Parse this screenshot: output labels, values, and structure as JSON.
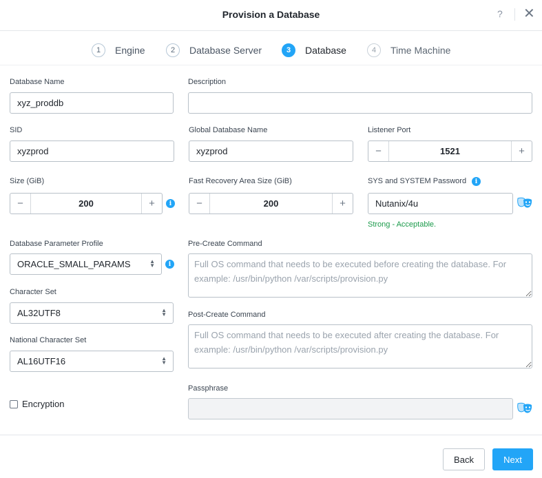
{
  "dialog": {
    "title": "Provision a Database",
    "help": "?",
    "close": "✕"
  },
  "steps": [
    {
      "num": "1",
      "label": "Engine"
    },
    {
      "num": "2",
      "label": "Database Server"
    },
    {
      "num": "3",
      "label": "Database"
    },
    {
      "num": "4",
      "label": "Time Machine"
    }
  ],
  "form": {
    "db_name": {
      "label": "Database Name",
      "value": "xyz_proddb"
    },
    "description": {
      "label": "Description",
      "value": ""
    },
    "sid": {
      "label": "SID",
      "value": "xyzprod"
    },
    "global_db_name": {
      "label": "Global Database Name",
      "value": "xyzprod"
    },
    "listener_port": {
      "label": "Listener Port",
      "value": "1521"
    },
    "size": {
      "label": "Size (GiB)",
      "value": "200"
    },
    "fra_size": {
      "label": "Fast Recovery Area Size (GiB)",
      "value": "200"
    },
    "sys_password": {
      "label": "SYS and SYSTEM Password",
      "value": "Nutanix/4u",
      "strength": "Strong - Acceptable."
    },
    "param_profile": {
      "label": "Database Parameter Profile",
      "value": "ORACLE_SMALL_PARAMS"
    },
    "pre_create": {
      "label": "Pre-Create Command",
      "placeholder": "Full OS command that needs to be executed before creating the database. For example: /usr/bin/python /var/scripts/provision.py"
    },
    "character_set": {
      "label": "Character Set",
      "value": "AL32UTF8"
    },
    "post_create": {
      "label": "Post-Create Command",
      "placeholder": "Full OS command that needs to be executed after creating the database. For example: /usr/bin/python /var/scripts/provision.py"
    },
    "national_character_set": {
      "label": "National Character Set",
      "value": "AL16UTF16"
    },
    "encryption": {
      "label": "Encryption",
      "checked": false
    },
    "passphrase": {
      "label": "Passphrase",
      "value": ""
    }
  },
  "stepper_symbols": {
    "minus": "−",
    "plus": "+"
  },
  "info_glyph": "i",
  "footer": {
    "back": "Back",
    "next": "Next"
  },
  "colors": {
    "accent": "#22a5f7",
    "success": "#1a9a4a"
  }
}
